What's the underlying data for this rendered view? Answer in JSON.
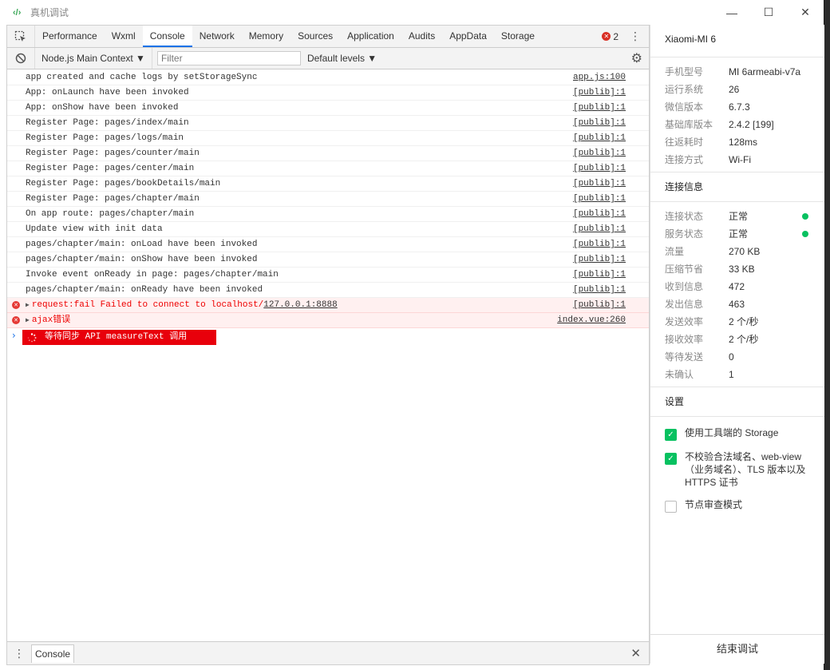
{
  "window": {
    "title": "真机调试",
    "controls": [
      "—",
      "☐",
      "✕"
    ]
  },
  "devtools": {
    "tabs": [
      "Performance",
      "Wxml",
      "Console",
      "Network",
      "Memory",
      "Sources",
      "Application",
      "Audits",
      "AppData",
      "Storage"
    ],
    "active_tab": "Console",
    "error_count": "2",
    "context": "Node.js Main Context ▼",
    "filter_placeholder": "Filter",
    "levels": "Default levels ▼"
  },
  "console": {
    "logs": [
      {
        "text": "app created and cache logs by setStorageSync",
        "src": "app.js:100"
      },
      {
        "text": "App: onLaunch have been invoked",
        "src": "[publib]:1"
      },
      {
        "text": "App: onShow have been invoked",
        "src": "[publib]:1"
      },
      {
        "text": "Register Page: pages/index/main",
        "src": "[publib]:1"
      },
      {
        "text": "Register Page: pages/logs/main",
        "src": "[publib]:1"
      },
      {
        "text": "Register Page: pages/counter/main",
        "src": "[publib]:1"
      },
      {
        "text": "Register Page: pages/center/main",
        "src": "[publib]:1"
      },
      {
        "text": "Register Page: pages/bookDetails/main",
        "src": "[publib]:1"
      },
      {
        "text": "Register Page: pages/chapter/main",
        "src": "[publib]:1"
      },
      {
        "text": "On app route: pages/chapter/main",
        "src": "[publib]:1"
      },
      {
        "text": "Update view with init data",
        "src": "[publib]:1"
      },
      {
        "text": "pages/chapter/main: onLoad have been invoked",
        "src": "[publib]:1"
      },
      {
        "text": "pages/chapter/main: onShow have been invoked",
        "src": "[publib]:1"
      },
      {
        "text": "Invoke event onReady in page: pages/chapter/main",
        "src": "[publib]:1"
      },
      {
        "text": "pages/chapter/main: onReady have been invoked",
        "src": "[publib]:1"
      }
    ],
    "errors": [
      {
        "text": "request:fail Failed to connect to localhost/",
        "link": "127.0.0.1:8888",
        "src": "[publib]:1"
      },
      {
        "text": "ajax错误",
        "link": "",
        "src": "index.vue:260"
      }
    ],
    "pending": "等待同步 API measureText 调用"
  },
  "drawer": {
    "tab": "Console"
  },
  "side": {
    "device": "Xiaomi-MI 6",
    "device_info": [
      {
        "k": "手机型号",
        "v": "MI 6armeabi-v7a"
      },
      {
        "k": "运行系统",
        "v": "26"
      },
      {
        "k": "微信版本",
        "v": "6.7.3"
      },
      {
        "k": "基础库版本",
        "v": "2.4.2 [199]"
      },
      {
        "k": "往返耗时",
        "v": "128ms"
      },
      {
        "k": "连接方式",
        "v": "Wi-Fi"
      }
    ],
    "conn_title": "连接信息",
    "conn_info": [
      {
        "k": "连接状态",
        "v": "正常",
        "dot": true
      },
      {
        "k": "服务状态",
        "v": "正常",
        "dot": true
      },
      {
        "k": "流量",
        "v": "270 KB"
      },
      {
        "k": "压缩节省",
        "v": "33 KB"
      },
      {
        "k": "收到信息",
        "v": "472"
      },
      {
        "k": "发出信息",
        "v": "463"
      },
      {
        "k": "发送效率",
        "v": "2 个/秒"
      },
      {
        "k": "接收效率",
        "v": "2 个/秒"
      },
      {
        "k": "等待发送",
        "v": "0"
      },
      {
        "k": "未确认",
        "v": "1"
      }
    ],
    "settings_title": "设置",
    "settings": [
      {
        "label": "使用工具端的 Storage",
        "checked": true
      },
      {
        "label": "不校验合法域名、web-view（业务域名）、TLS 版本以及 HTTPS 证书",
        "checked": true
      },
      {
        "label": "节点审查模式",
        "checked": false
      }
    ],
    "end_button": "结束调试"
  },
  "colors": {
    "accent": "#1a73e8",
    "error": "#e00000",
    "success": "#07c160",
    "pending_bg": "#e8000b"
  }
}
